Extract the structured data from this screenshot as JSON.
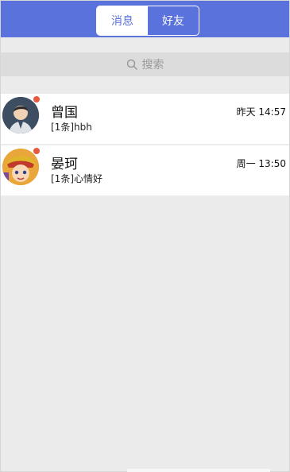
{
  "colors": {
    "brand": "#5a72db",
    "badge": "#e85a3c"
  },
  "tabs": [
    {
      "label": "消息",
      "active": true
    },
    {
      "label": "好友",
      "active": false
    }
  ],
  "search": {
    "placeholder": "搜索",
    "icon": "search-icon"
  },
  "conversations": [
    {
      "name": "曾国",
      "preview": "[1条]hbh",
      "time": "昨天 14:57",
      "unread": true,
      "avatar": "avatar-man-icon"
    },
    {
      "name": "晏珂",
      "preview": "[1条]心情好",
      "time": "周一 13:50",
      "unread": true,
      "avatar": "avatar-cartoon-icon"
    }
  ]
}
